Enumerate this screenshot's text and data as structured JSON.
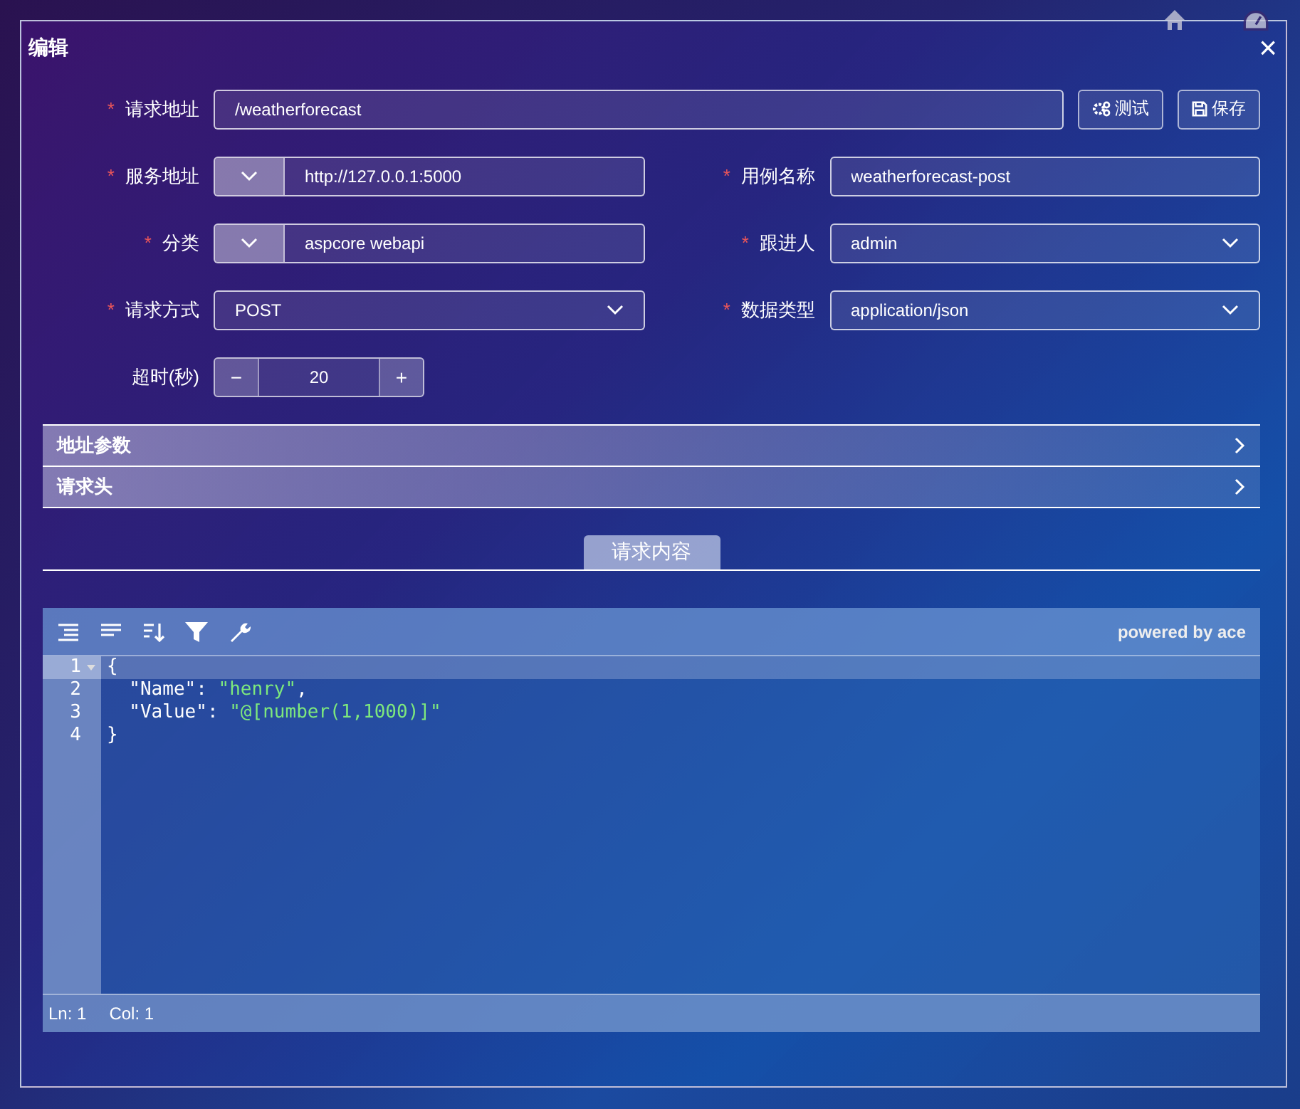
{
  "dialog": {
    "title": "编辑",
    "close": "×"
  },
  "required_mark": "*",
  "url_row": {
    "label": "请求地址",
    "required": true,
    "value": "/weatherforecast",
    "buttons": [
      {
        "kind": "test",
        "label": "测试"
      },
      {
        "kind": "save",
        "label": "保存"
      }
    ]
  },
  "fields": [
    {
      "label": "服务地址",
      "required": true,
      "kind": "prefixed",
      "value": "http://127.0.0.1:5000"
    },
    {
      "label": "用例名称",
      "required": true,
      "kind": "text",
      "value": "weatherforecast-post"
    },
    {
      "label": "分类",
      "required": true,
      "kind": "prefixed",
      "value": "aspcore webapi"
    },
    {
      "label": "跟进人",
      "required": true,
      "kind": "select",
      "value": "admin"
    },
    {
      "label": "请求方式",
      "required": true,
      "kind": "select",
      "value": "POST"
    },
    {
      "label": "数据类型",
      "required": true,
      "kind": "select",
      "value": "application/json"
    }
  ],
  "timeout": {
    "label": "超时(秒)",
    "minus": "−",
    "value": "20",
    "plus": "+"
  },
  "panels": [
    {
      "title": "地址参数",
      "expanded": false
    },
    {
      "title": "请求头",
      "expanded": false
    }
  ],
  "tabs": [
    {
      "label": "请求内容",
      "selected": true
    }
  ],
  "editor": {
    "powered_by": "powered by ace",
    "lines": [
      {
        "number": "1",
        "active": true,
        "foldable": true,
        "tokens": [
          {
            "kind": "punct",
            "text": "{"
          }
        ]
      },
      {
        "number": "2",
        "active": false,
        "foldable": false,
        "tokens": [
          {
            "kind": "key",
            "text": "  \"Name\""
          },
          {
            "kind": "punct",
            "text": ": "
          },
          {
            "kind": "string",
            "text": "\"henry\""
          },
          {
            "kind": "punct",
            "text": ","
          }
        ]
      },
      {
        "number": "3",
        "active": false,
        "foldable": false,
        "tokens": [
          {
            "kind": "key",
            "text": "  \"Value\""
          },
          {
            "kind": "punct",
            "text": ": "
          },
          {
            "kind": "string",
            "text": "\"@[number(1,1000)]\""
          }
        ]
      },
      {
        "number": "4",
        "active": false,
        "foldable": false,
        "tokens": [
          {
            "kind": "punct",
            "text": "}"
          }
        ]
      }
    ],
    "status": [
      {
        "label": "Ln: 1"
      },
      {
        "label": "Col: 1"
      }
    ]
  }
}
